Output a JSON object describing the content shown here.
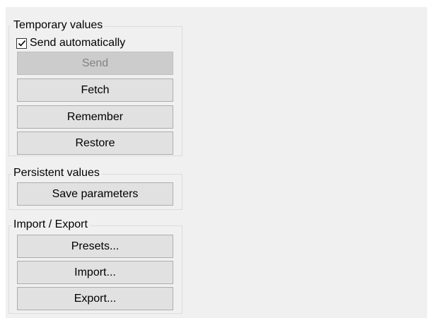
{
  "temporary": {
    "title": "Temporary values",
    "send_automatically": {
      "label": "Send automatically",
      "checked": true
    },
    "buttons": {
      "send": {
        "label": "Send",
        "enabled": false
      },
      "fetch": {
        "label": "Fetch",
        "enabled": true
      },
      "remember": {
        "label": "Remember",
        "enabled": true
      },
      "restore": {
        "label": "Restore",
        "enabled": true
      }
    }
  },
  "persistent": {
    "title": "Persistent values",
    "buttons": {
      "save": {
        "label": "Save parameters",
        "enabled": true
      }
    }
  },
  "import_export": {
    "title": "Import / Export",
    "buttons": {
      "presets": {
        "label": "Presets...",
        "enabled": true
      },
      "import": {
        "label": "Import...",
        "enabled": true
      },
      "export": {
        "label": "Export...",
        "enabled": true
      }
    }
  }
}
